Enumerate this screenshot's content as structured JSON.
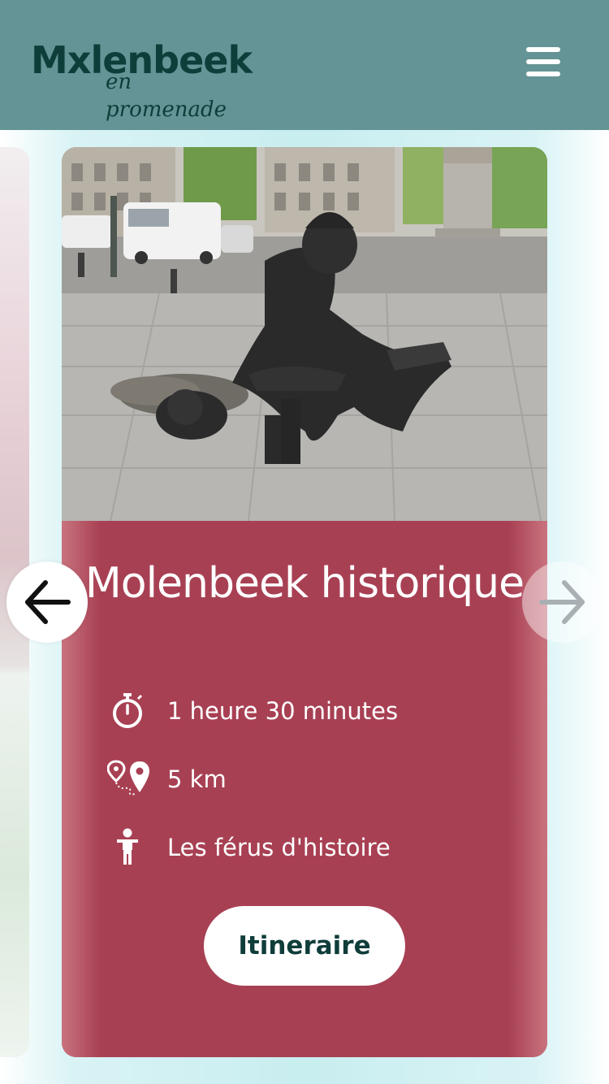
{
  "header": {
    "logo_main": "Mxlenbeek",
    "logo_sub": "en promenade",
    "menu_icon": "hamburger-menu-icon",
    "background_color": "#649495"
  },
  "card": {
    "title": "Molenbeek historique",
    "background_color": "#a84053",
    "photo_alt": "bronze statue of a policeman and a figure emerging from a manhole",
    "info": {
      "duration": "1 heure 30 minutes",
      "distance": "5 km",
      "audience": "Les férus d'histoire"
    },
    "icons": {
      "duration": "stopwatch-icon",
      "distance": "route-pin-icon",
      "audience": "person-icon"
    },
    "button_label": "Itineraire"
  },
  "carousel": {
    "prev_icon": "arrow-left-icon",
    "next_icon": "arrow-right-icon"
  }
}
